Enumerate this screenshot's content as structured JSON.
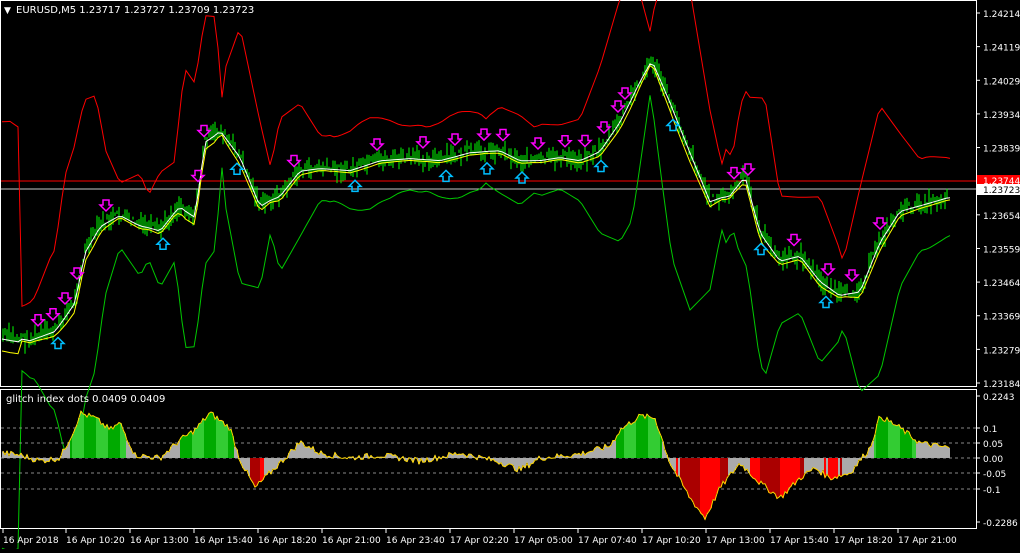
{
  "main_chart": {
    "header_arrow": "▼",
    "title": "EURUSD,M5  1.23717 1.23727 1.23709 1.23723",
    "price_labels": [
      "1.24214",
      "1.24119",
      "1.24029",
      "1.23934",
      "1.23839",
      "1.23744",
      "1.23654",
      "1.23559",
      "1.23464",
      "1.23369",
      "1.23279",
      "1.23184"
    ],
    "current_price": "1.23723",
    "red_line_label": "1.23744",
    "colors": {
      "background": "#000000",
      "candle": "#00ff00",
      "upper_band": "#ff0000",
      "lower_band": "#00c800",
      "signal_line": "#ffff00",
      "ma_line": "#ffffff",
      "sell_arrow": "#ff00ff",
      "buy_arrow": "#00bfff",
      "hline_red": "#ff0000",
      "hline_white": "#c8c8c8"
    },
    "icons": {
      "sell": "down-arrow-icon",
      "buy": "up-arrow-icon"
    }
  },
  "indicator": {
    "title": "glitch index dots 0.0409 0.0409",
    "levels_labels": [
      "0.2243",
      "0.1",
      "0.05",
      "0.00",
      "-0.05",
      "-0.1",
      "-0.2286"
    ],
    "colors": {
      "positive_strong": "#00aa00",
      "positive_light": "#33cc33",
      "negative_strong": "#ff0000",
      "negative_dark": "#aa0000",
      "line": "#ffd700",
      "neutral_bar": "#aaaaaa"
    }
  },
  "time_axis": {
    "labels": [
      "16 Apr 2018",
      "16 Apr 10:20",
      "16 Apr 13:00",
      "16 Apr 15:40",
      "16 Apr 18:20",
      "16 Apr 21:00",
      "16 Apr 23:40",
      "17 Apr 02:20",
      "17 Apr 05:00",
      "17 Apr 07:40",
      "17 Apr 10:20",
      "17 Apr 13:00",
      "17 Apr 15:40",
      "17 Apr 18:20",
      "17 Apr 21:00"
    ]
  }
}
